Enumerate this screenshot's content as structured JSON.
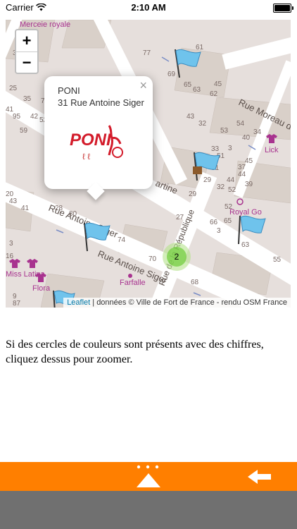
{
  "status_bar": {
    "carrier": "Carrier",
    "time": "2:10 AM"
  },
  "map": {
    "zoom_in": "+",
    "zoom_out": "−",
    "popup": {
      "name": "PONI",
      "address": "31 Rue Antoine Siger",
      "close": "×",
      "logo_text": "PONI"
    },
    "cluster_count": "2",
    "attribution_link": "Leaflet",
    "attribution_text": " | données © Ville de Fort de France - rendu OSM France",
    "streets": [
      "Rue Antoine Siger",
      "Rue Antoine Siger",
      "Rue Moreau d",
      "Rue de la République",
      "artine"
    ],
    "shops": [
      "Merceie royale",
      "Lick",
      "Royal Go",
      "Farfalle",
      "Miss Latina",
      "Flora"
    ],
    "house_numbers": [
      "31",
      "25",
      "35",
      "75",
      "42",
      "41",
      "59",
      "52",
      "95",
      "77",
      "69",
      "65",
      "63",
      "62",
      "43",
      "32",
      "53",
      "40",
      "34",
      "51",
      "33",
      "31",
      "29",
      "44",
      "44",
      "45",
      "52",
      "20",
      "43",
      "41",
      "28",
      "80",
      "27",
      "74",
      "70",
      "66",
      "3",
      "65",
      "63",
      "55",
      "16",
      "3",
      "9",
      "87",
      "29",
      "68",
      "3",
      "37",
      "54",
      "32",
      "39",
      "52",
      "61",
      "45"
    ]
  },
  "info_text": "Si des cercles de couleurs sont présents avec des chiffres, cliquez dessus pour zoomer.",
  "toolbar": {
    "menu_dots": "•••"
  },
  "colors": {
    "toolbar": "#ff7f00",
    "bottom_bar": "#707070",
    "cluster": "#6ecc39",
    "flag": "#6fc3ec"
  }
}
